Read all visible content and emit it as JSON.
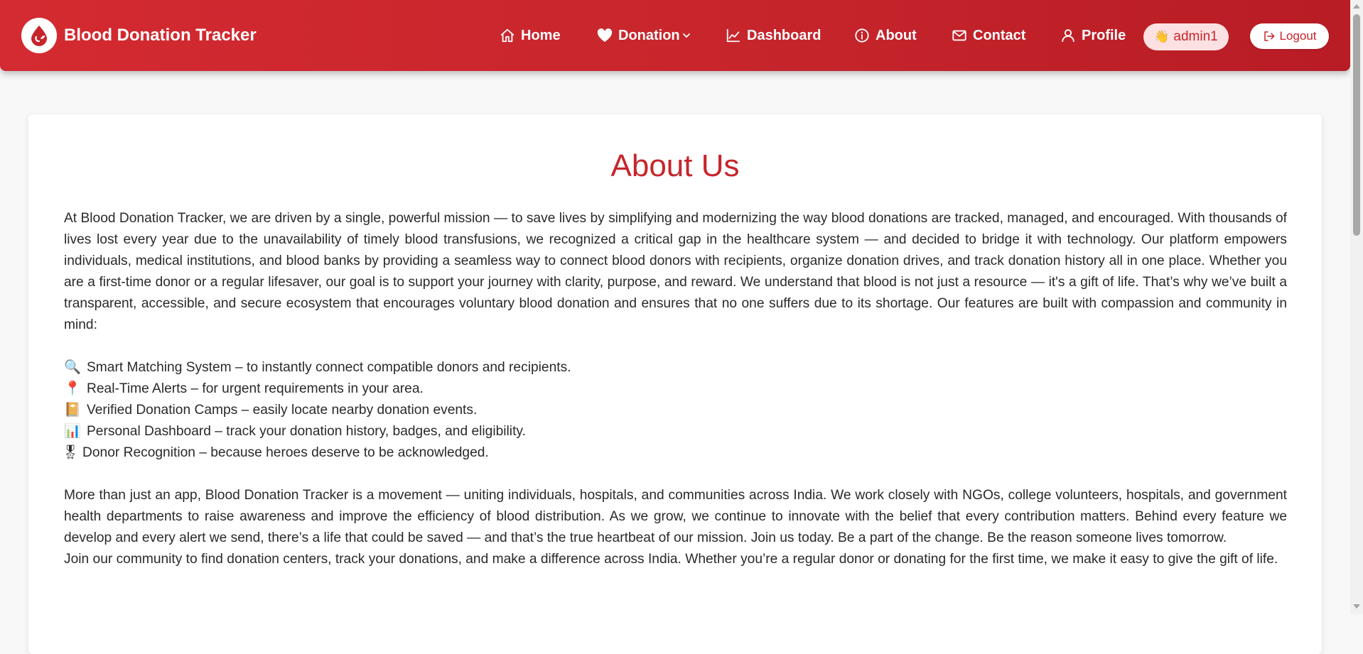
{
  "navbar": {
    "brand_title": "Blood Donation Tracker",
    "items": [
      {
        "label": "Home",
        "icon": "home-icon"
      },
      {
        "label": "Donation",
        "icon": "heart-icon",
        "has_dropdown": true
      },
      {
        "label": "Dashboard",
        "icon": "chart-icon"
      },
      {
        "label": "About",
        "icon": "info-icon"
      },
      {
        "label": "Contact",
        "icon": "mail-icon"
      },
      {
        "label": "Profile",
        "icon": "user-icon"
      }
    ],
    "user": {
      "wave": "👋",
      "name": "admin1"
    },
    "logout_label": "Logout",
    "colors": {
      "primary": "#c7252c",
      "pill_bg": "#fde1e2"
    }
  },
  "about": {
    "title": "About Us",
    "intro": "At Blood Donation Tracker, we are driven by a single, powerful mission — to save lives by simplifying and modernizing the way blood donations are tracked, managed, and encouraged. With thousands of lives lost every year due to the unavailability of timely blood transfusions, we recognized a critical gap in the healthcare system — and decided to bridge it with technology. Our platform empowers individuals, medical institutions, and blood banks by providing a seamless way to connect blood donors with recipients, organize donation drives, and track donation history all in one place. Whether you are a first-time donor or a regular lifesaver, our goal is to support your journey with clarity, purpose, and reward. We understand that blood is not just a resource — it's a gift of life. That’s why we’ve built a transparent, accessible, and secure ecosystem that encourages voluntary blood donation and ensures that no one suffers due to its shortage. Our features are built with compassion and community in mind:",
    "features": [
      {
        "icon": "🔍",
        "text": "Smart Matching System – to instantly connect compatible donors and recipients."
      },
      {
        "icon": "📍",
        "text": "Real-Time Alerts – for urgent requirements in your area."
      },
      {
        "icon": "📔",
        "text": "Verified Donation Camps – easily locate nearby donation events."
      },
      {
        "icon": "📊",
        "text": "Personal Dashboard – track your donation history, badges, and eligibility."
      },
      {
        "icon": "🎖",
        "text": "Donor Recognition – because heroes deserve to be acknowledged."
      }
    ],
    "movement": "More than just an app, Blood Donation Tracker is a movement — uniting individuals, hospitals, and communities across India. We work closely with NGOs, college volunteers, hospitals, and government health departments to raise awareness and improve the efficiency of blood distribution. As we grow, we continue to innovate with the belief that every contribution matters. Behind every feature we develop and every alert we send, there’s a life that could be saved — and that’s the true heartbeat of our mission. Join us today. Be a part of the change. Be the reason someone lives tomorrow.",
    "closing": "Join our community to find donation centers, track your donations, and make a difference across India. Whether you’re a regular donor or donating for the first time, we make it easy to give the gift of life."
  }
}
